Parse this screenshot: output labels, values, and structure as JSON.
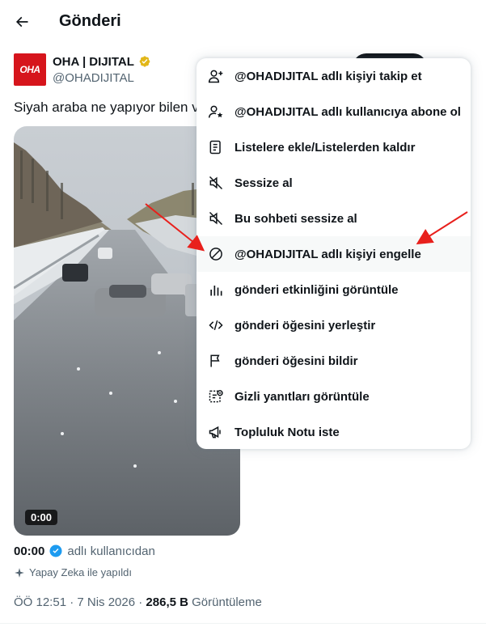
{
  "header": {
    "title": "Gönderi",
    "back_icon": "arrow-left-icon"
  },
  "author": {
    "avatar_text": "OHA",
    "name": "OHA | DIJITAL",
    "handle": "@OHADIJITAL",
    "verified_color": "#e2b719"
  },
  "tweet": {
    "text": "Siyah araba ne yapıyor bilen v",
    "video": {
      "time": "0:00"
    },
    "attribution": {
      "time": "00:00",
      "suffix": "adlı kullanıcıdan"
    },
    "ai_label": "Yapay Zeka ile yapıldı",
    "meta": {
      "timestamp": "ÖÖ 12:51 · 7 Nis 2026 · ",
      "views": "286,5 B",
      "views_label": " Görüntüleme"
    }
  },
  "menu": {
    "items": [
      {
        "label": "@OHADIJITAL adlı kişiyi takip et",
        "icon": "follow-user-icon"
      },
      {
        "label": "@OHADIJITAL adlı kullanıcıya abone ol",
        "icon": "subscribe-user-icon"
      },
      {
        "label": "Listelere ekle/Listelerden kaldır",
        "icon": "list-icon"
      },
      {
        "label": "Sessize al",
        "icon": "mute-icon"
      },
      {
        "label": "Bu sohbeti sessize al",
        "icon": "mute-conversation-icon"
      },
      {
        "label": "@OHADIJITAL adlı kişiyi engelle",
        "icon": "block-icon"
      },
      {
        "label": "gönderi etkinliğini görüntüle",
        "icon": "analytics-icon"
      },
      {
        "label": "gönderi öğesini yerleştir",
        "icon": "embed-icon"
      },
      {
        "label": "gönderi öğesini bildir",
        "icon": "flag-icon"
      },
      {
        "label": "Gizli yanıtları görüntüle",
        "icon": "hidden-replies-icon"
      },
      {
        "label": "Topluluk Notu iste",
        "icon": "megaphone-icon"
      }
    ]
  },
  "colors": {
    "accent": "#1d9bf0",
    "annotation": "#e8201c",
    "text": "#0f1419",
    "muted": "#536471"
  }
}
